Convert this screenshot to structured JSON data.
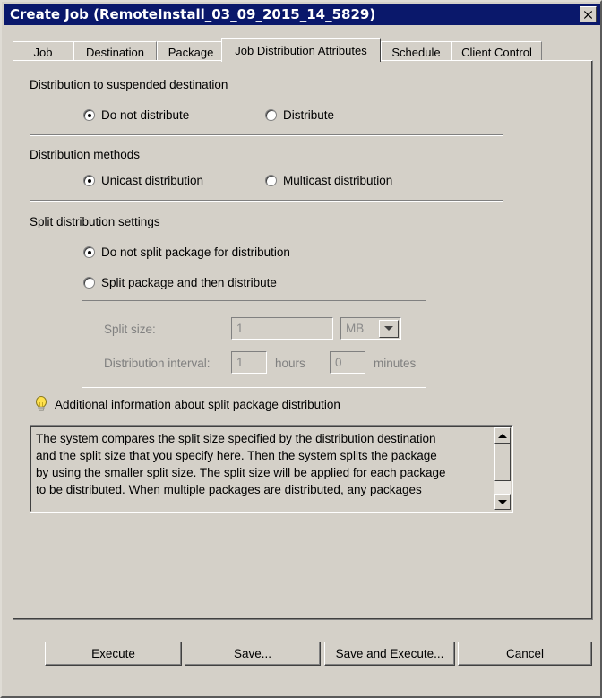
{
  "window": {
    "title": "Create Job (RemoteInstall_03_09_2015_14_5829)",
    "close_label": "✕",
    "titlebar_color": "#0a186b",
    "face_color": "#d4d0c8"
  },
  "tabs": [
    {
      "label": "Job",
      "selected": false
    },
    {
      "label": "Destination",
      "selected": false
    },
    {
      "label": "Package",
      "selected": false
    },
    {
      "label": "Job Distribution Attributes",
      "selected": true
    },
    {
      "label": "Schedule",
      "selected": false
    },
    {
      "label": "Client Control",
      "selected": false
    }
  ],
  "sections": {
    "suspended": {
      "title": "Distribution to suspended destination",
      "options": [
        {
          "label": "Do not distribute",
          "checked": true
        },
        {
          "label": "Distribute",
          "checked": false
        }
      ]
    },
    "methods": {
      "title": "Distribution methods",
      "options": [
        {
          "label": "Unicast distribution",
          "checked": true
        },
        {
          "label": "Multicast distribution",
          "checked": false
        }
      ]
    },
    "split": {
      "title": "Split distribution settings",
      "options": [
        {
          "label": "Do not split package for distribution",
          "checked": true
        },
        {
          "label": "Split package and then distribute",
          "checked": false
        }
      ],
      "fields": {
        "split_size_label": "Split size:",
        "split_size_value": "1",
        "split_size_unit": "MB",
        "interval_label": "Distribution interval:",
        "interval_hours_value": "1",
        "interval_hours_unit": "hours",
        "interval_minutes_value": "0",
        "interval_minutes_unit": "minutes"
      }
    }
  },
  "info": {
    "icon": "lightbulb-icon",
    "text": "Additional information about split package distribution",
    "body_lines": [
      "The system compares the split size specified by the distribution destination",
      "and the split size that you specify here.  Then the system splits the package",
      "by using the smaller split size.  The split size will be applied for each package",
      "to be distributed.  When multiple packages are distributed, any packages"
    ],
    "scroll_up": "▲",
    "scroll_down": "▼"
  },
  "footer": {
    "buttons": [
      {
        "label": "Execute"
      },
      {
        "label": "Save..."
      },
      {
        "label": "Save and Execute..."
      },
      {
        "label": "Cancel"
      }
    ]
  }
}
